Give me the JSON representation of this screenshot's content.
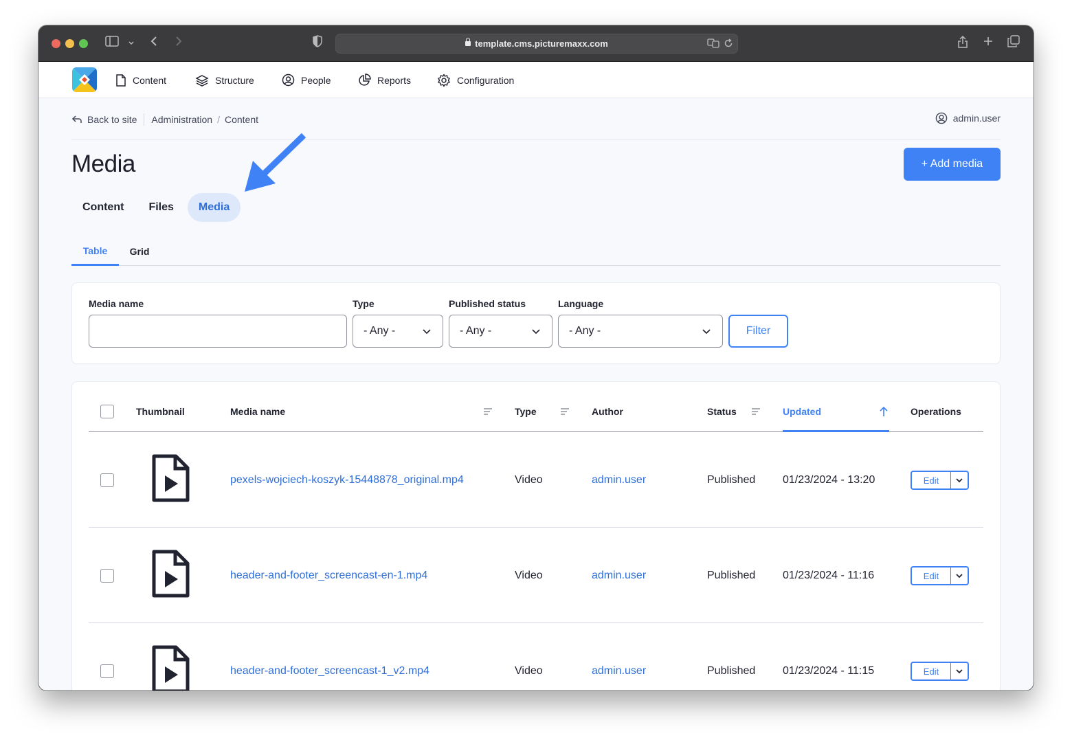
{
  "browser": {
    "url": "template.cms.picturemaxx.com"
  },
  "toolbar": {
    "items": [
      {
        "label": "Content",
        "icon": "file-icon"
      },
      {
        "label": "Structure",
        "icon": "layers-icon"
      },
      {
        "label": "People",
        "icon": "user-circle-icon"
      },
      {
        "label": "Reports",
        "icon": "pie-chart-icon"
      },
      {
        "label": "Configuration",
        "icon": "gear-icon"
      }
    ]
  },
  "breadcrumb": {
    "back": "Back to site",
    "items": [
      "Administration",
      "Content"
    ]
  },
  "user": "admin.user",
  "page": {
    "title": "Media",
    "add_button": "+ Add media"
  },
  "primary_tabs": [
    "Content",
    "Files",
    "Media"
  ],
  "primary_active": "Media",
  "secondary_tabs": [
    "Table",
    "Grid"
  ],
  "secondary_active": "Table",
  "filters": {
    "name_label": "Media name",
    "name_value": "",
    "type_label": "Type",
    "type_value": "- Any -",
    "status_label": "Published status",
    "status_value": "- Any -",
    "language_label": "Language",
    "language_value": "- Any -",
    "button": "Filter"
  },
  "table": {
    "columns": [
      "Thumbnail",
      "Media name",
      "Type",
      "Author",
      "Status",
      "Updated",
      "Operations"
    ],
    "sorted_column": "Updated",
    "sort_direction": "ascending",
    "rows": [
      {
        "name": "pexels-wojciech-koszyk-15448878_original.mp4",
        "type": "Video",
        "author": "admin.user",
        "status": "Published",
        "updated": "01/23/2024 - 13:20",
        "op": "Edit"
      },
      {
        "name": "header-and-footer_screencast-en-1.mp4",
        "type": "Video",
        "author": "admin.user",
        "status": "Published",
        "updated": "01/23/2024 - 11:16",
        "op": "Edit"
      },
      {
        "name": "header-and-footer_screencast-1_v2.mp4",
        "type": "Video",
        "author": "admin.user",
        "status": "Published",
        "updated": "01/23/2024 - 11:15",
        "op": "Edit"
      }
    ]
  },
  "colors": {
    "accent": "#3f82f5",
    "link": "#2f6fd9",
    "active_tab_bg": "#dde8fb",
    "annotation_arrow": "#3f82f5"
  }
}
